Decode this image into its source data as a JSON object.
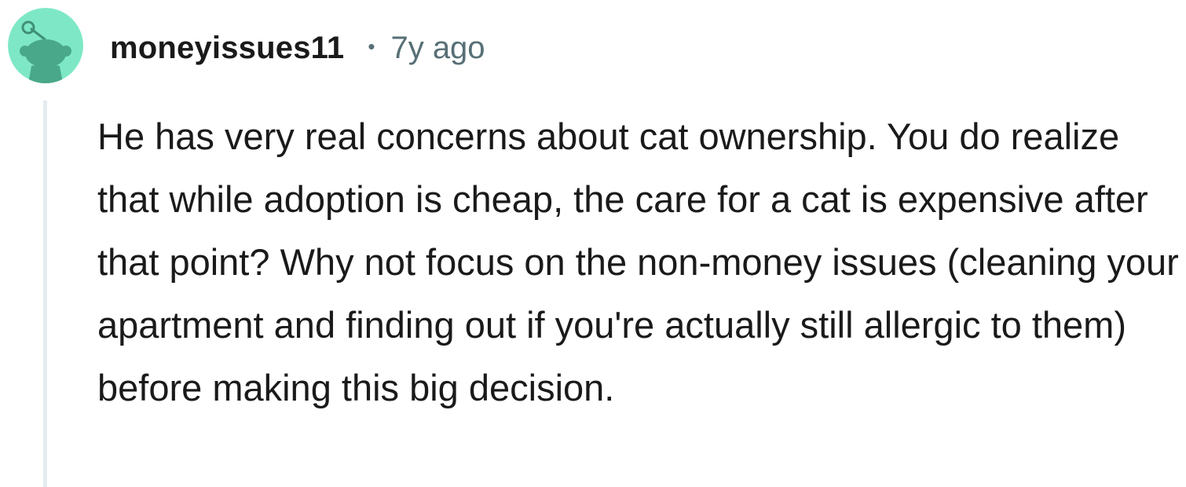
{
  "comment": {
    "author": "moneyissues11",
    "separator": "•",
    "timestamp": "7y ago",
    "avatar_icon": "reddit-snoo-avatar-icon",
    "colors": {
      "avatar_bg": "#7ee8c6",
      "avatar_figure": "#4aa88a",
      "thread_line": "#e5ebee",
      "meta_text": "#576f76",
      "body_text": "#1a1a1b"
    },
    "body": "He has very real concerns about cat ownership. You do realize that while adoption is cheap, the care for a cat is expensive after that point? Why not focus on the non-money issues (cleaning your apartment and finding out if you're actually still allergic to them) before making this big decision."
  }
}
